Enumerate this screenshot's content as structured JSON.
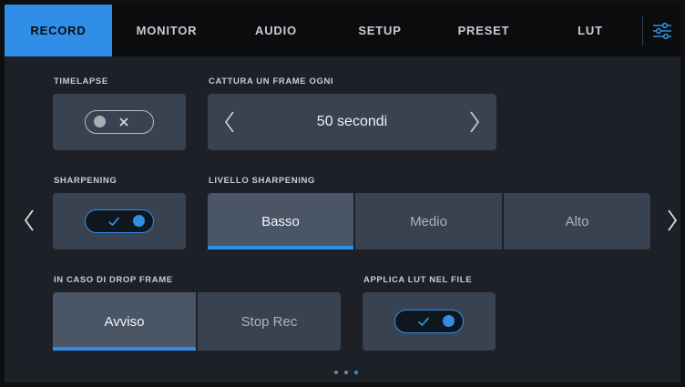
{
  "tabs": [
    {
      "label": "RECORD",
      "active": true
    },
    {
      "label": "MONITOR",
      "active": false
    },
    {
      "label": "AUDIO",
      "active": false
    },
    {
      "label": "SETUP",
      "active": false
    },
    {
      "label": "PRESET",
      "active": false
    },
    {
      "label": "LUT",
      "active": false
    }
  ],
  "menu_icon": "sliders-icon",
  "timelapse": {
    "label": "TIMELAPSE",
    "state": "off"
  },
  "frame_interval": {
    "label": "CATTURA UN FRAME OGNI",
    "value": "50 secondi"
  },
  "sharpening": {
    "label": "SHARPENING",
    "state": "on"
  },
  "sharpening_level": {
    "label": "LIVELLO SHARPENING",
    "options": [
      "Basso",
      "Medio",
      "Alto"
    ],
    "selected": "Basso"
  },
  "drop_frame": {
    "label": "IN CASO DI DROP FRAME",
    "options": [
      "Avviso",
      "Stop Rec"
    ],
    "selected": "Avviso"
  },
  "apply_lut": {
    "label": "APPLICA LUT NEL FILE",
    "state": "on"
  },
  "pagination": {
    "pages": 3,
    "current": 3
  },
  "colors": {
    "accent": "#2f8fe8",
    "panel": "#394250",
    "panel_selected": "#4a5566",
    "background": "#1d2127",
    "tabbar": "#0b0c0e"
  }
}
